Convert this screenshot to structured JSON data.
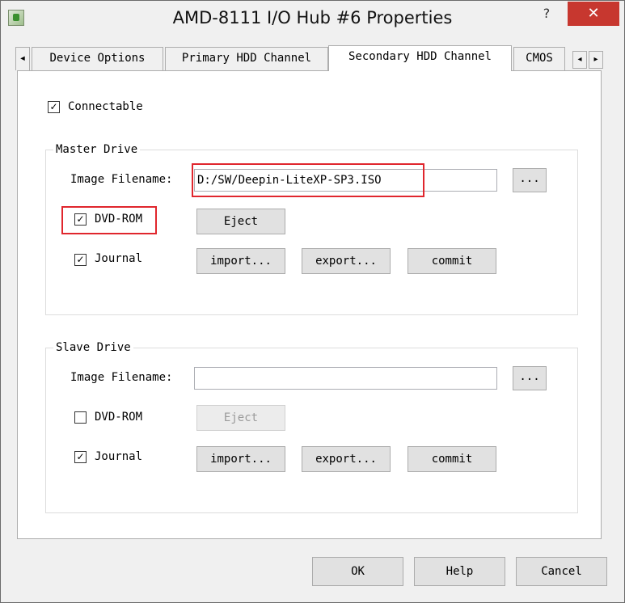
{
  "window": {
    "title": "AMD-8111 I/O Hub #6 Properties",
    "help_glyph": "?",
    "close_glyph": "✕"
  },
  "tabs": [
    {
      "label": "Device Options"
    },
    {
      "label": "Primary HDD Channel"
    },
    {
      "label": "Secondary HDD Channel",
      "active": true
    },
    {
      "label": "CMOS"
    }
  ],
  "tab_scroll": {
    "left_glyph": "◂",
    "right_glyph": "▸",
    "first_glyph": "◂"
  },
  "connectable": {
    "label": "Connectable",
    "checked": true
  },
  "master": {
    "group_label": "Master Drive",
    "image_label": "Image Filename:",
    "image_value": "D:/SW/Deepin-LiteXP-SP3.ISO",
    "browse_label": "...",
    "dvdrom_label": "DVD-ROM",
    "dvdrom_checked": true,
    "eject_label": "Eject",
    "journal_label": "Journal",
    "journal_checked": true,
    "import_label": "import...",
    "export_label": "export...",
    "commit_label": "commit"
  },
  "slave": {
    "group_label": "Slave Drive",
    "image_label": "Image Filename:",
    "image_value": "",
    "browse_label": "...",
    "dvdrom_label": "DVD-ROM",
    "dvdrom_checked": false,
    "eject_label": "Eject",
    "journal_label": "Journal",
    "journal_checked": true,
    "import_label": "import...",
    "export_label": "export...",
    "commit_label": "commit"
  },
  "footer": {
    "ok_label": "OK",
    "help_label": "Help",
    "cancel_label": "Cancel"
  },
  "check_glyph": "✓",
  "colors": {
    "close_button": "#c7372f",
    "highlight_box": "#e0262d"
  }
}
